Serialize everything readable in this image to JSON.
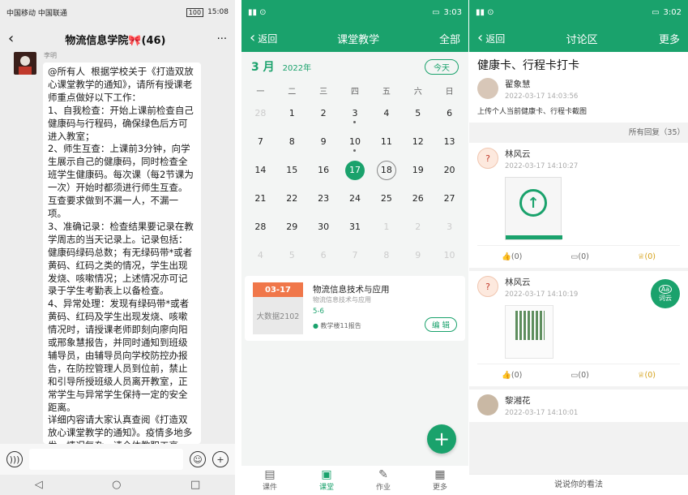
{
  "wechat": {
    "status_left": "中国移动 中国联通",
    "status_right": "15:08",
    "battery": "100",
    "title": "物流信息学院🎀(46)",
    "more": "···",
    "sender": "李明",
    "message": "@所有人  根据学校关于《打造双放心课堂教学的通知》，请所有授课老师重点做好以下工作：\n1、自我检查：开始上课前检查自己健康码与行程码，确保绿色后方可进入教室；\n2、师生互查：上课前3分钟，向学生展示自己的健康码，同时检查全班学生健康码。每次课（每2节课为一次）开始时都须进行师生互查。互查要求做到不漏一人，不漏一项。\n3、准确记录：检查结果要记录在教学周志的当天记录上。记录包括：健康码绿码总数；有无绿码带*或者黄码、红码之类的情况，学生出现发烧、咳嗽情况；上述情况亦可记录于学生考勤表上以备检查。\n4、异常处理：发现有绿码带*或者黄码、红码及学生出现发烧、咳嗽情况时，请授课老师即刻向廖向阳或邢象慧报告，并同时通知到班级辅导员，由辅导员向学校防控办报告，在防控管理人员到位前，禁止和引导所授班级人员离开教室，正常学生与异常学生保持一定的安全距离。\n详细内容请大家认真查阅《打造双放心课堂教学的通知》。疫情多地多发，情况复杂，请全体教职工高"
  },
  "schedule": {
    "status_time": "3:03",
    "back_label": "返回",
    "title": "课堂教学",
    "all_label": "全部",
    "month": "3 月",
    "year": "2022年",
    "today_label": "今天",
    "weekdays": [
      "一",
      "二",
      "三",
      "四",
      "五",
      "六",
      "日"
    ],
    "days": [
      {
        "n": "28",
        "dim": true
      },
      {
        "n": "1"
      },
      {
        "n": "2"
      },
      {
        "n": "3",
        "dot": true
      },
      {
        "n": "4"
      },
      {
        "n": "5"
      },
      {
        "n": "6"
      },
      {
        "n": "7"
      },
      {
        "n": "8"
      },
      {
        "n": "9"
      },
      {
        "n": "10",
        "dot": true
      },
      {
        "n": "11"
      },
      {
        "n": "12"
      },
      {
        "n": "13"
      },
      {
        "n": "14"
      },
      {
        "n": "15"
      },
      {
        "n": "16"
      },
      {
        "n": "17",
        "sel": true
      },
      {
        "n": "18",
        "tod": true
      },
      {
        "n": "19"
      },
      {
        "n": "20"
      },
      {
        "n": "21"
      },
      {
        "n": "22"
      },
      {
        "n": "23"
      },
      {
        "n": "24"
      },
      {
        "n": "25"
      },
      {
        "n": "26"
      },
      {
        "n": "27"
      },
      {
        "n": "28"
      },
      {
        "n": "29"
      },
      {
        "n": "30"
      },
      {
        "n": "31"
      },
      {
        "n": "1",
        "dim": true
      },
      {
        "n": "2",
        "dim": true
      },
      {
        "n": "3",
        "dim": true
      },
      {
        "n": "4",
        "dim": true
      },
      {
        "n": "5",
        "dim": true
      },
      {
        "n": "6",
        "dim": true
      },
      {
        "n": "7",
        "dim": true
      },
      {
        "n": "8",
        "dim": true
      },
      {
        "n": "9",
        "dim": true
      },
      {
        "n": "10",
        "dim": true
      }
    ],
    "course": {
      "date": "03-17",
      "room": "大数据2102",
      "name": "物流信息技术与应用",
      "sub": "物流信息技术与应用",
      "weeks": "5-6",
      "location": "教学楼11报告",
      "edit_label": "编 辑"
    },
    "fab": "+",
    "tabs": [
      {
        "label": "课件",
        "icon": "▤"
      },
      {
        "label": "课堂",
        "icon": "▣",
        "active": true
      },
      {
        "label": "作业",
        "icon": "✎"
      },
      {
        "label": "更多",
        "icon": "▦"
      }
    ]
  },
  "discuss": {
    "status_time": "3:02",
    "back_label": "返回",
    "title": "讨论区",
    "more_label": "更多",
    "post_title": "健康卡、行程卡打卡",
    "post_author": "翟象慧",
    "post_time": "2022-03-17 14:03:56",
    "post_body": "上传个人当前健康卡、行程卡截图",
    "replies_label": "所有回复（35）",
    "reply1_name": "林风云",
    "reply1_time": "2022-03-17 14:10:27",
    "reply2_name": "林风云",
    "reply2_time": "2022-03-17 14:10:19",
    "reply3_name": "黎湘花",
    "reply3_time": "2022-03-17 14:10:01",
    "like": "(0)",
    "comment": "(0)",
    "reward": "(0)",
    "fab_label": "词云",
    "comment_placeholder": "说说你的看法"
  }
}
